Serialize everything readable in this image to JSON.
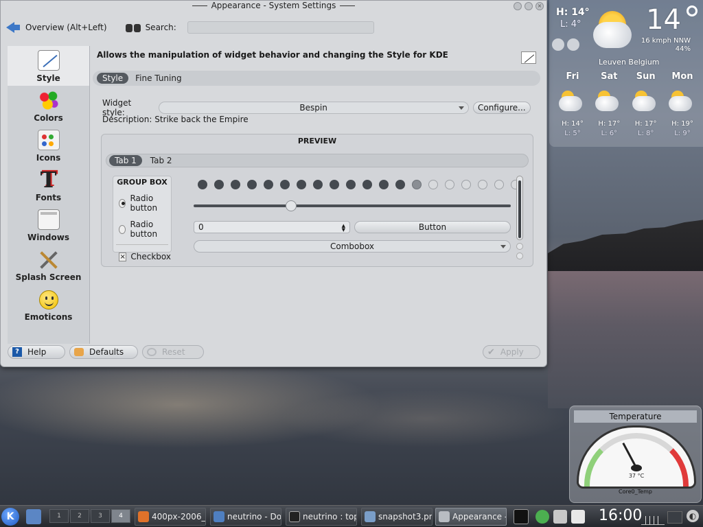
{
  "window": {
    "title": "Appearance - System Settings",
    "back_label": "Overview (Alt+Left)",
    "search_label": "Search:",
    "search_value": ""
  },
  "sidebar": {
    "items": [
      {
        "label": "Style",
        "icon": "style-icon"
      },
      {
        "label": "Colors",
        "icon": "colors-icon"
      },
      {
        "label": "Icons",
        "icon": "icons-icon"
      },
      {
        "label": "Fonts",
        "icon": "fonts-icon"
      },
      {
        "label": "Windows",
        "icon": "windows-icon"
      },
      {
        "label": "Splash Screen",
        "icon": "splash-screen-icon"
      },
      {
        "label": "Emoticons",
        "icon": "emoticons-icon"
      }
    ],
    "active_index": 0
  },
  "content": {
    "header": "Allows the manipulation of widget behavior and changing the Style for KDE",
    "tabs": [
      "Style",
      "Fine Tuning"
    ],
    "widget_style_label": "Widget style:",
    "widget_style_value": "Bespin",
    "configure_label": "Configure...",
    "description": "Description: Strike back the Empire",
    "preview": {
      "title": "PREVIEW",
      "tabs": [
        "Tab 1",
        "Tab 2"
      ],
      "groupbox_title": "GROUP BOX",
      "radio1": "Radio button",
      "radio2": "Radio button",
      "checkbox": "Checkbox",
      "progress_filled": 13,
      "progress_half": 1,
      "progress_empty": 6,
      "slider_value": 0.3,
      "spin_value": "0",
      "button": "Button",
      "combobox": "Combobox"
    }
  },
  "buttons": {
    "help": "Help",
    "defaults": "Defaults",
    "reset": "Reset",
    "apply": "Apply"
  },
  "weather": {
    "high": "H: 14°",
    "low": "L: 4°",
    "current": "14",
    "wind": "16 kmph NNW",
    "humidity": "44%",
    "location": "Leuven Belgium",
    "forecast": [
      {
        "day": "Fri",
        "high": "H: 14°",
        "low": "L: 5°"
      },
      {
        "day": "Sat",
        "high": "H: 17°",
        "low": "L: 6°"
      },
      {
        "day": "Sun",
        "high": "H: 17°",
        "low": "L: 8°"
      },
      {
        "day": "Mon",
        "high": "H: 19°",
        "low": "L: 9°"
      }
    ]
  },
  "temperature": {
    "title": "Temperature",
    "value": "37 °C",
    "sensor": "Core0_Temp"
  },
  "taskbar": {
    "pager": [
      "1",
      "2",
      "3",
      "4"
    ],
    "active_desktop": 3,
    "tasks": [
      {
        "label": "400px-2006_",
        "icon": "firefox-icon"
      },
      {
        "label": "neutrino - Dol",
        "icon": "dolphin-icon"
      },
      {
        "label": "neutrino : top",
        "icon": "terminal-icon"
      },
      {
        "label": "snapshot3.pn",
        "icon": "image-icon"
      },
      {
        "label": "Appearance -",
        "icon": "tools-icon"
      }
    ],
    "active_task": 4,
    "clock": "16:00"
  }
}
